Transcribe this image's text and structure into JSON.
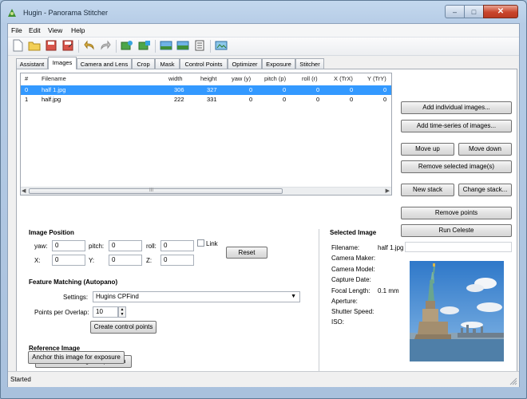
{
  "window": {
    "title": "Hugin - Panorama Stitcher"
  },
  "menu": [
    "File",
    "Edit",
    "View",
    "Help"
  ],
  "toolbar_icons": [
    "new-project-icon",
    "open-project-icon",
    "save-icon",
    "save-as-icon",
    "undo-icon",
    "redo-icon",
    "add-images-icon",
    "add-time-series-icon",
    "preview-icon",
    "fast-preview-icon",
    "layout-preview-icon",
    "gl-preview-icon"
  ],
  "tabs": [
    "Assistant",
    "Images",
    "Camera and Lens",
    "Crop",
    "Mask",
    "Control Points",
    "Optimizer",
    "Exposure",
    "Stitcher"
  ],
  "active_tab": "Images",
  "image_list": {
    "columns": [
      "#",
      "Filename",
      "width",
      "height",
      "yaw (y)",
      "pitch (p)",
      "roll (r)",
      "X (TrX)",
      "Y (TrY)"
    ],
    "rows": [
      [
        "0",
        "half 1.jpg",
        "306",
        "327",
        "0",
        "0",
        "0",
        "0",
        "0"
      ],
      [
        "1",
        "half.jpg",
        "222",
        "331",
        "0",
        "0",
        "0",
        "0",
        "0"
      ]
    ],
    "selected_row": 0,
    "scroll_hint": "III"
  },
  "buttons": {
    "add_individual": "Add individual images...",
    "add_time_series": "Add time-series of images...",
    "move_up": "Move up",
    "move_down": "Move down",
    "remove_selected": "Remove selected image(s)",
    "new_stack": "New stack",
    "change_stack": "Change stack...",
    "remove_points": "Remove points",
    "run_celeste": "Run Celeste",
    "reset": "Reset",
    "create_cp": "Create control points",
    "anchor_position": "Anchor this image for position",
    "anchor_exposure": "Anchor this image for exposure"
  },
  "image_position": {
    "heading": "Image Position",
    "yaw_label": "yaw:",
    "yaw": "0",
    "pitch_label": "pitch:",
    "pitch": "0",
    "roll_label": "roll:",
    "roll": "0",
    "x_label": "X:",
    "x": "0",
    "y_label": "Y:",
    "y": "0",
    "z_label": "Z:",
    "z": "0",
    "link_label": "Link"
  },
  "feature_matching": {
    "heading": "Feature Matching (Autopano)",
    "settings_label": "Settings:",
    "settings_value": "Hugins CPFind",
    "ppo_label": "Points per Overlap:",
    "ppo_value": "10"
  },
  "reference_image": {
    "heading": "Reference Image"
  },
  "selected_image": {
    "heading": "Selected Image",
    "fields": [
      {
        "label": "Filename:",
        "value": "half 1.jpg"
      },
      {
        "label": "Camera Maker:",
        "value": ""
      },
      {
        "label": "Camera Model:",
        "value": ""
      },
      {
        "label": "Capture Date:",
        "value": ""
      },
      {
        "label": "Focal Length:",
        "value": "0.1 mm"
      },
      {
        "label": "Aperture:",
        "value": ""
      },
      {
        "label": "Shutter Speed:",
        "value": ""
      },
      {
        "label": "ISO:",
        "value": ""
      }
    ]
  },
  "status": "Started",
  "colors": {
    "selection": "#3399ff",
    "sky": "#3f87d4"
  }
}
